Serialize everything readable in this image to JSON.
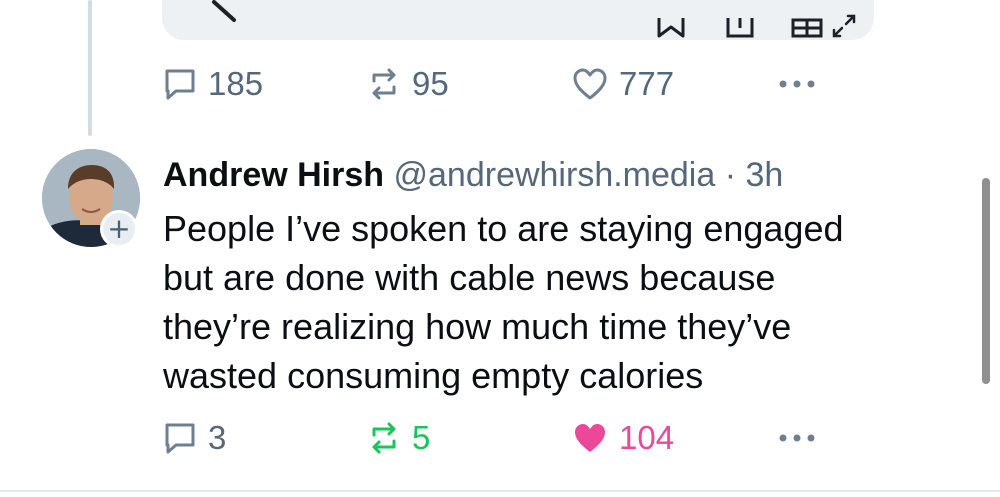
{
  "colors": {
    "text_primary": "#0b0f14",
    "text_secondary": "#55677a",
    "icon_gray": "#6d7f90",
    "repost_active": "#19c45a",
    "like_active": "#ec4899",
    "thread_line": "#d4dbe2"
  },
  "previous_post": {
    "media_icons": [
      "back-arrow-icon",
      "bookmark-icon",
      "share-icon",
      "layout-icon",
      "expand-icon"
    ],
    "replies": "185",
    "reposts": "95",
    "likes": "777"
  },
  "post": {
    "author_name": "Andrew Hirsh",
    "author_handle": "@andrewhirsh.media",
    "separator": "·",
    "time": "3h",
    "follow_symbol": "+",
    "text_lines": [
      "People I’ve spoken to are staying engaged",
      "but are done with cable news because",
      "they’re realizing how much time they’ve",
      "wasted consuming empty calories"
    ],
    "replies": "3",
    "reposts": "5",
    "likes": "104",
    "reposted": true,
    "liked": true
  }
}
